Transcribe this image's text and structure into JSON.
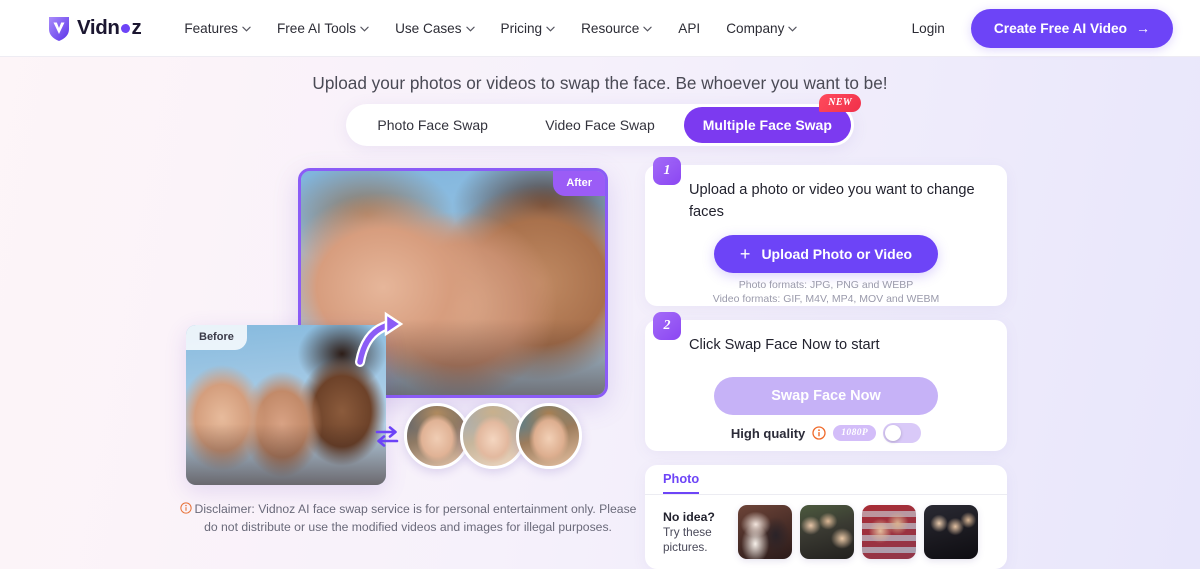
{
  "header": {
    "logo": {
      "text_a": "Vidn",
      "text_b": "z",
      "icon": "vidnoz-logo-icon"
    },
    "nav": [
      {
        "label": "Features",
        "has_dropdown": true
      },
      {
        "label": "Free AI Tools",
        "has_dropdown": true
      },
      {
        "label": "Use Cases",
        "has_dropdown": true
      },
      {
        "label": "Pricing",
        "has_dropdown": true
      },
      {
        "label": "Resource",
        "has_dropdown": true
      },
      {
        "label": "API",
        "has_dropdown": false
      },
      {
        "label": "Company",
        "has_dropdown": true
      }
    ],
    "login_label": "Login",
    "cta_label": "Create Free AI Video",
    "cta_arrow": "→",
    "cta_color": "#6D44F7"
  },
  "hero": {
    "subheadline": "Upload your photos or videos to swap the face. Be whoever you want to be!"
  },
  "tabs": {
    "items": [
      {
        "label": "Photo Face Swap",
        "active": false,
        "badge": ""
      },
      {
        "label": "Video Face Swap",
        "active": false,
        "badge": ""
      },
      {
        "label": "Multiple Face Swap",
        "active": true,
        "badge": "NEW"
      }
    ],
    "active_color": "#7C3AF0",
    "badge_color": "#F0304A"
  },
  "preview": {
    "after_label": "After",
    "before_label": "Before",
    "after_border_color": "#8B5CF6",
    "face_thumbs": [
      {
        "name": "face-option-1"
      },
      {
        "name": "face-option-2"
      },
      {
        "name": "face-option-3"
      }
    ]
  },
  "disclaimer": {
    "text": "Disclaimer: Vidnoz AI face swap service is for personal entertainment only. Please do not distribute or use the modified videos and images for illegal purposes.",
    "icon": "info-circle-icon",
    "icon_color": "#E8743B"
  },
  "steps": [
    {
      "number": "1",
      "title": "Upload a photo or video you want to change faces",
      "button_label": "Upload Photo or Video",
      "button_icon": "plus-icon",
      "format_line_1": "Photo formats: JPG, PNG and WEBP",
      "format_line_2": "Video formats: GIF, M4V, MP4, MOV and WEBM"
    },
    {
      "number": "2",
      "title": "Click Swap Face Now to start",
      "button_label": "Swap Face Now",
      "quality_label": "High quality",
      "quality_info_icon": "info-circle-icon",
      "quality_pill": "1080P",
      "toggle_state": "off"
    }
  ],
  "examples": {
    "tab_label": "Photo",
    "heading": "No idea?",
    "sub_line_1": "Try these",
    "sub_line_2": "pictures.",
    "thumbnails": [
      {
        "name": "example-photo-wedding"
      },
      {
        "name": "example-photo-group"
      },
      {
        "name": "example-photo-flag"
      },
      {
        "name": "example-photo-school"
      }
    ]
  }
}
